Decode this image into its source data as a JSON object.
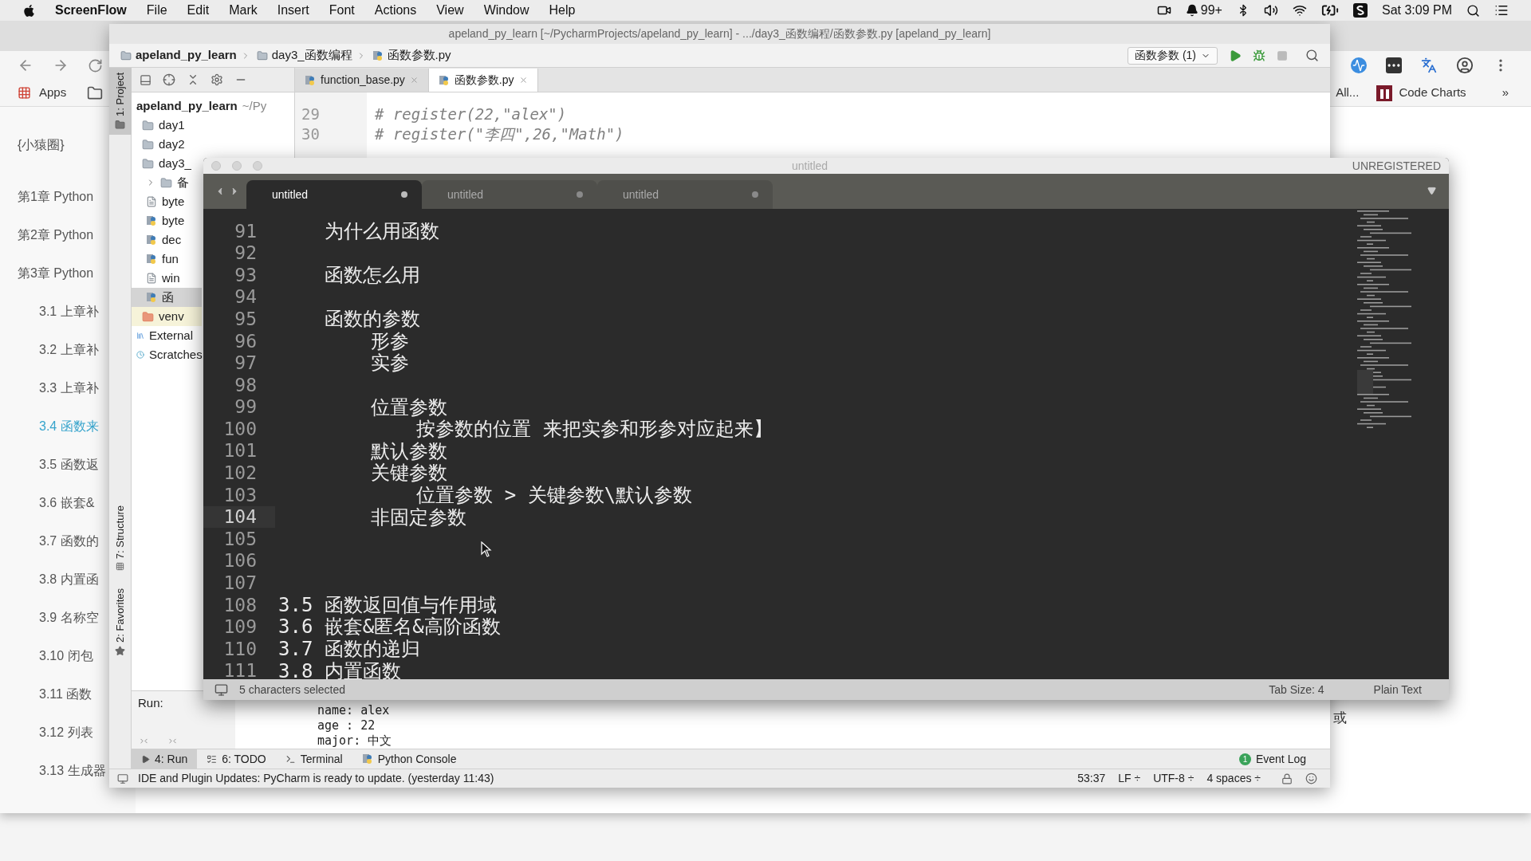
{
  "menu_bar": {
    "app": "ScreenFlow",
    "menus": [
      "File",
      "Edit",
      "Mark",
      "Insert",
      "Font",
      "Actions",
      "View",
      "Window",
      "Help"
    ],
    "notification_count": "99+",
    "clock": "Sat 3:09 PM"
  },
  "browser": {
    "bookmarks": [
      "Apps"
    ],
    "bookmarks_right": [
      "All...",
      "Code Charts"
    ],
    "overflow": "»",
    "sidebar": {
      "title": "{小猿圈}",
      "items": [
        {
          "label": "第1章 Python",
          "kind": "chapter",
          "selected": false
        },
        {
          "label": "第2章 Python",
          "kind": "chapter",
          "selected": false
        },
        {
          "label": "第3章 Python",
          "kind": "chapter",
          "selected": false
        },
        {
          "label": "3.1 上章补",
          "kind": "section",
          "selected": false
        },
        {
          "label": "3.2 上章补",
          "kind": "section",
          "selected": false
        },
        {
          "label": "3.3 上章补",
          "kind": "section",
          "selected": false
        },
        {
          "label": "3.4 函数来",
          "kind": "section",
          "selected": true
        },
        {
          "label": "3.5 函数返",
          "kind": "section",
          "selected": false
        },
        {
          "label": "3.6 嵌套&",
          "kind": "section",
          "selected": false
        },
        {
          "label": "3.7 函数的",
          "kind": "section",
          "selected": false
        },
        {
          "label": "3.8 内置函",
          "kind": "section",
          "selected": false
        },
        {
          "label": "3.9 名称空",
          "kind": "section",
          "selected": false
        },
        {
          "label": "3.10 闭包",
          "kind": "section",
          "selected": false
        },
        {
          "label": "3.11 函数",
          "kind": "section",
          "selected": false
        },
        {
          "label": "3.12 列表",
          "kind": "section",
          "selected": false
        },
        {
          "label": "3.13 生成器",
          "kind": "section",
          "selected": false
        }
      ]
    },
    "content_fragment": "或"
  },
  "pycharm": {
    "title": "apeland_py_learn [~/PycharmProjects/apeland_py_learn] - .../day3_函数编程/函数参数.py [apeland_py_learn]",
    "breadcrumbs": [
      {
        "label": "apeland_py_learn",
        "kind": "folder"
      },
      {
        "label": "day3_函数编程",
        "kind": "folder"
      },
      {
        "label": "函数参数.py",
        "kind": "py"
      }
    ],
    "run_config": "函数参数 (1)",
    "side_tools": {
      "top": "1: Project",
      "structure": "7: Structure",
      "favorites": "2: Favorites"
    },
    "tabs": [
      {
        "label": "function_base.py",
        "selected": false
      },
      {
        "label": "函数参数.py",
        "selected": true
      }
    ],
    "project_tree": [
      {
        "label": "apeland_py_learn",
        "hint": "~/Py",
        "kind": "root",
        "selected": false,
        "children": [
          {
            "label": "day1",
            "kind": "folder",
            "selected": false
          },
          {
            "label": "day2",
            "kind": "folder",
            "selected": false
          },
          {
            "label": "day3_",
            "kind": "folder",
            "selected": false,
            "children": [
              {
                "label": "备",
                "kind": "collapsed-folder",
                "selected": false
              },
              {
                "label": "byte",
                "kind": "file",
                "selected": false
              },
              {
                "label": "byte",
                "kind": "py",
                "selected": false
              },
              {
                "label": "dec",
                "kind": "py",
                "selected": false
              },
              {
                "label": "fun",
                "kind": "py",
                "selected": false
              },
              {
                "label": "win",
                "kind": "file",
                "selected": false
              },
              {
                "label": "函",
                "kind": "py",
                "selected": true
              }
            ]
          },
          {
            "label": "venv",
            "kind": "venv",
            "selected": false
          }
        ]
      },
      {
        "label": "External",
        "kind": "library",
        "selected": false
      },
      {
        "label": "Scratches",
        "kind": "scratch",
        "selected": false
      }
    ],
    "editor_lines": [
      {
        "number": "29",
        "text": "# register(22,\"alex\")"
      },
      {
        "number": "30",
        "text": "# register(\"李四\",26,\"Math\")"
      }
    ],
    "run_panel": {
      "label": "Run:",
      "output": [
        "name: alex",
        "age : 22",
        "major: 中文"
      ]
    },
    "tool_tabs": [
      {
        "label": "4: Run",
        "kind": "run",
        "selected": true
      },
      {
        "label": "6: TODO",
        "kind": "todo",
        "selected": false
      },
      {
        "label": "Terminal",
        "kind": "terminal",
        "selected": false
      },
      {
        "label": "Python Console",
        "kind": "console",
        "selected": false
      }
    ],
    "event_log": {
      "label": "Event Log",
      "count": "1"
    },
    "status_bar": {
      "message": "IDE and Plugin Updates: PyCharm is ready to update. (yesterday 11:43)",
      "items": [
        "53:37",
        "LF ÷",
        "UTF-8 ÷",
        "4 spaces ÷"
      ]
    }
  },
  "sublime": {
    "title": "untitled",
    "license": "UNREGISTERED",
    "tabs": [
      {
        "label": "untitled",
        "selected": true,
        "modified": true
      },
      {
        "label": "untitled",
        "selected": false,
        "modified": true
      },
      {
        "label": "untitled",
        "selected": false,
        "modified": true
      }
    ],
    "lines": [
      {
        "number": "91",
        "text": "    为什么用函数",
        "current": false
      },
      {
        "number": "92",
        "current": false
      },
      {
        "number": "93",
        "text": "    函数怎么用",
        "current": false
      },
      {
        "number": "94",
        "current": false
      },
      {
        "number": "95",
        "text": "    函数的参数",
        "current": false
      },
      {
        "number": "96",
        "text": "        形参",
        "current": false
      },
      {
        "number": "97",
        "text": "        实参",
        "current": false
      },
      {
        "number": "98",
        "current": false
      },
      {
        "number": "99",
        "text": "        位置参数",
        "current": false
      },
      {
        "number": "100",
        "text": "            按参数的位置 来把实参和形参对应起来】",
        "current": false
      },
      {
        "number": "101",
        "text": "        默认参数",
        "current": false
      },
      {
        "number": "102",
        "text": "        关键参数",
        "current": false
      },
      {
        "number": "103",
        "text": "            位置参数 > 关键参数\\默认参数",
        "current": false
      },
      {
        "number": "104",
        "text": "        非固定参数",
        "current": true
      },
      {
        "number": "105",
        "current": false
      },
      {
        "number": "106",
        "current": false
      },
      {
        "number": "107",
        "current": false
      },
      {
        "number": "108",
        "text": "3.5 函数返回值与作用域",
        "current": false
      },
      {
        "number": "109",
        "text": "3.6 嵌套&匿名&高阶函数",
        "current": false
      },
      {
        "number": "110",
        "text": "3.7 函数的递归",
        "current": false
      },
      {
        "number": "111",
        "text": "3.8 内置函数",
        "current": false
      }
    ],
    "status_bar": {
      "selection": "5 characters selected",
      "tab_size": "Tab Size: 4",
      "syntax": "Plain Text"
    }
  }
}
